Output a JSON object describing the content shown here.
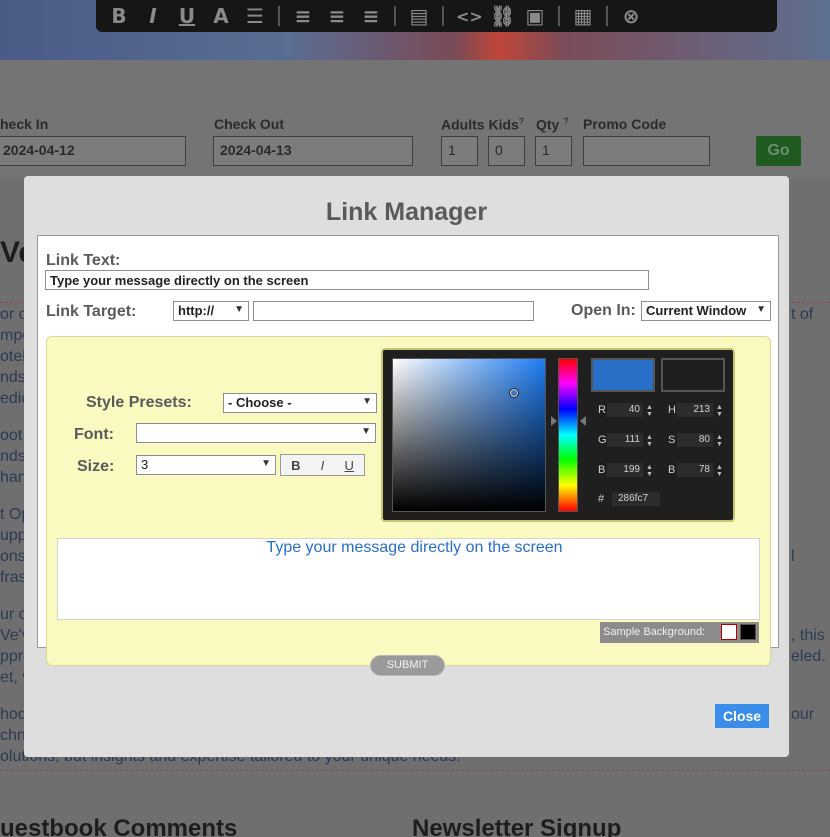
{
  "editor_toolbar": {
    "buttons": [
      {
        "icon": "bold-icon",
        "glyph": "B"
      },
      {
        "icon": "italic-icon",
        "glyph": "I"
      },
      {
        "icon": "underline-icon",
        "glyph": "U"
      },
      {
        "icon": "font-icon",
        "glyph": "A"
      },
      {
        "icon": "list-icon",
        "glyph": "☰"
      },
      {
        "icon": "align-left-icon",
        "glyph": "≡"
      },
      {
        "icon": "align-center-icon",
        "glyph": "≡"
      },
      {
        "icon": "align-right-icon",
        "glyph": "≡"
      },
      {
        "icon": "document-icon",
        "glyph": "▤"
      },
      {
        "icon": "code-icon",
        "glyph": "<>"
      },
      {
        "icon": "link-icon",
        "glyph": "⛓"
      },
      {
        "icon": "image-icon",
        "glyph": "▣"
      },
      {
        "icon": "save-icon",
        "glyph": "▦"
      },
      {
        "icon": "close-icon",
        "glyph": "⊗"
      }
    ]
  },
  "booking": {
    "check_in_label": "heck In",
    "check_in_value": "2024-04-12",
    "check_out_label": "Check Out",
    "check_out_value": "2024-04-13",
    "adults_label": "Adults",
    "kids_label": "Kids",
    "qty_label": "Qty",
    "help_mark": "?",
    "promo_label": "Promo Code",
    "adults_value": "1",
    "kids_value": "0",
    "qty_value": "1",
    "go_label": "Go"
  },
  "background_page": {
    "heading_fragment": "Ve",
    "right_fragment_1": "t of",
    "right_fragment_2": "l",
    "right_fragment_3": ", this",
    "right_fragment_4": "eled.",
    "right_fragment_5": "our",
    "bottom_text": "olutions, but insights and expertise tailored to your unique needs.",
    "left_fragments": [
      "or c",
      "mpo",
      "otel",
      "nds",
      "edic",
      "oot",
      "nds",
      "han",
      "t Op",
      "upp",
      "ons",
      "fras",
      "ur c",
      "Ve'v",
      "ppro",
      "et, v",
      "hod",
      "chn"
    ],
    "guestbook_heading": "uestbook Comments",
    "newsletter_heading": "Newsletter Signup"
  },
  "modal": {
    "title": "Link Manager",
    "link_text_label": "Link Text:",
    "link_text_value": "Type your message directly on the screen",
    "link_target_label": "Link Target:",
    "protocol_value": "http://",
    "url_value": "",
    "open_in_label": "Open In:",
    "open_in_value": "Current Window",
    "style_presets_label": "Style Presets:",
    "style_presets_value": "- Choose -",
    "font_label": "Font:",
    "font_value": "",
    "size_label": "Size:",
    "size_value": "3",
    "bold_label": "B",
    "italic_label": "I",
    "underline_label": "U",
    "preview_text": "Type your message directly on the screen",
    "sample_background_label": "Sample Background:",
    "submit_label": "SUBMIT",
    "close_label": "Close"
  },
  "color_picker": {
    "r_label": "R",
    "r_value": "40",
    "g_label": "G",
    "g_value": "111",
    "b_label": "B",
    "b_value": "199",
    "h_label": "H",
    "h_value": "213",
    "s_label": "S",
    "s_value": "80",
    "bright_label": "B",
    "bright_value": "78",
    "hex_label": "#",
    "hex_value": "286fc7",
    "new_color": "#286fc7",
    "current_color": "#1e1e1e"
  }
}
